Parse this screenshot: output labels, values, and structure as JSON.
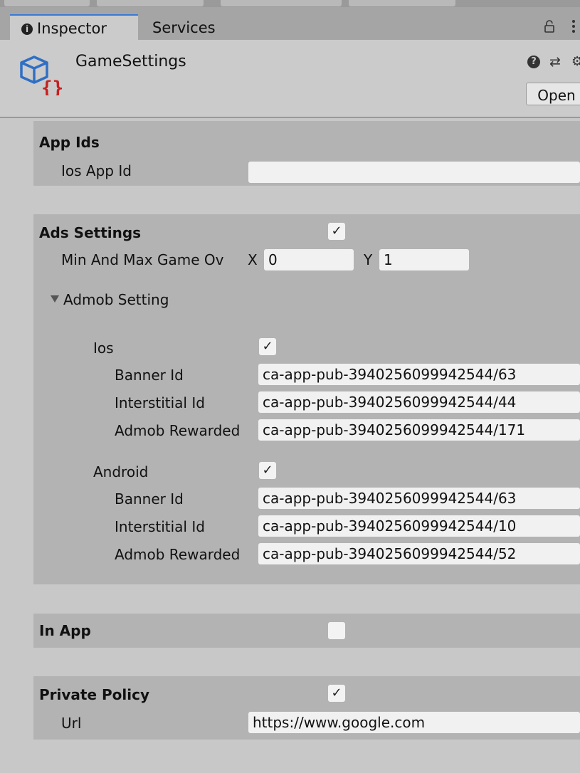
{
  "tabs": {
    "inspector": "Inspector",
    "services": "Services"
  },
  "asset": {
    "title": "GameSettings",
    "help": "?",
    "open_label": "Open"
  },
  "app_ids": {
    "header": "App Ids",
    "ios_label": "Ios App Id",
    "ios_value": ""
  },
  "ads": {
    "header": "Ads Settings",
    "enabled": true,
    "range_label": "Min And Max Game Ov",
    "x_label": "X",
    "x_value": "0",
    "y_label": "Y",
    "y_value": "1",
    "admob_label": "Admob Setting",
    "ios": {
      "label": "Ios",
      "enabled": true,
      "banner_label": "Banner Id",
      "banner_value": "ca-app-pub-3940256099942544/63",
      "interstitial_label": "Interstitial Id",
      "interstitial_value": "ca-app-pub-3940256099942544/44",
      "rewarded_label": "Admob Rewarded",
      "rewarded_value": "ca-app-pub-3940256099942544/171"
    },
    "android": {
      "label": "Android",
      "enabled": true,
      "banner_label": "Banner Id",
      "banner_value": "ca-app-pub-3940256099942544/63",
      "interstitial_label": "Interstitial Id",
      "interstitial_value": "ca-app-pub-3940256099942544/10",
      "rewarded_label": "Admob Rewarded",
      "rewarded_value": "ca-app-pub-3940256099942544/52"
    }
  },
  "in_app": {
    "header": "In App",
    "enabled": false
  },
  "privacy": {
    "header": "Private Policy",
    "enabled": true,
    "url_label": "Url",
    "url_value": "https://www.google.com"
  },
  "colors": {
    "tab_accent": "#3a79d6",
    "panel": "#b3b3b3",
    "background": "#c8c8c8",
    "icon_red": "#c62020",
    "icon_blue": "#2f6fc4"
  }
}
